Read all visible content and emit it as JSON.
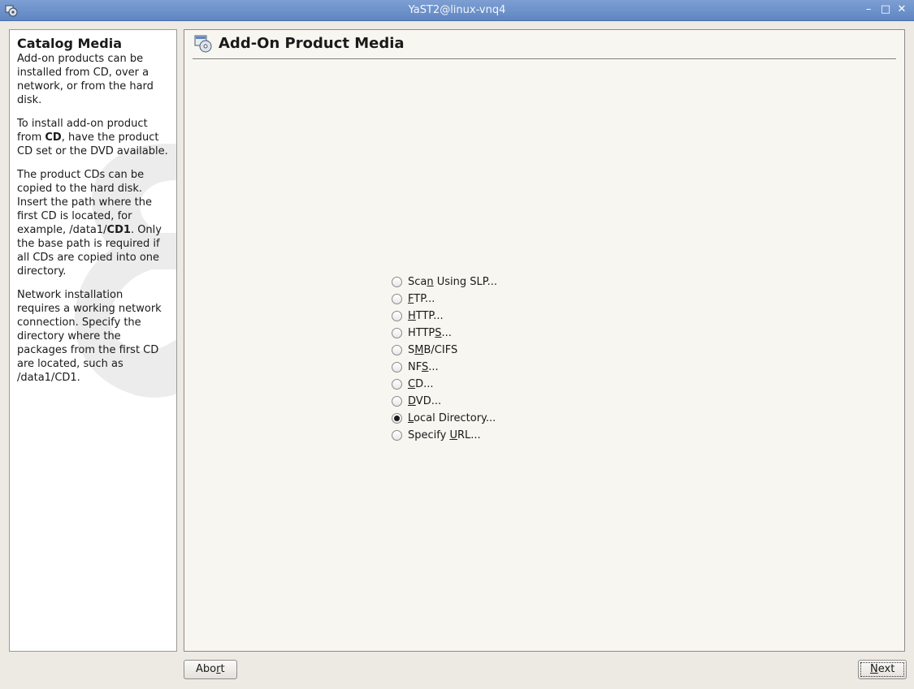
{
  "window": {
    "title": "YaST2@linux-vnq4"
  },
  "help": {
    "title": "Catalog Media",
    "paragraphs": [
      [
        "Add-on products can be installed from CD, over a network, or from the hard disk."
      ],
      [
        "To install add-on product from ",
        {
          "b": "CD"
        },
        ", have the product CD set or the DVD available."
      ],
      [
        "The product CDs can be copied to the hard disk. Insert the path where the first CD is located, for example, /data1/",
        {
          "b": "CD1"
        },
        ". Only the base path is required if all CDs are copied into one directory."
      ],
      [
        "Network installation requires a working network connection. Specify the directory where the packages from the first CD are located, such as /data1/CD1."
      ]
    ]
  },
  "main": {
    "title": "Add-On Product Media",
    "options": [
      {
        "label": "Scan Using SLP...",
        "mnemonic_index": 3,
        "checked": false
      },
      {
        "label": "FTP...",
        "mnemonic_index": 0,
        "checked": false
      },
      {
        "label": "HTTP...",
        "mnemonic_index": 0,
        "checked": false
      },
      {
        "label": "HTTPS...",
        "mnemonic_index": 4,
        "checked": false
      },
      {
        "label": "SMB/CIFS",
        "mnemonic_index": 1,
        "checked": false
      },
      {
        "label": "NFS...",
        "mnemonic_index": 2,
        "checked": false
      },
      {
        "label": "CD...",
        "mnemonic_index": 0,
        "checked": false
      },
      {
        "label": "DVD...",
        "mnemonic_index": 0,
        "checked": false
      },
      {
        "label": "Local Directory...",
        "mnemonic_index": 0,
        "checked": true
      },
      {
        "label": "Specify URL...",
        "mnemonic_index": 8,
        "checked": false
      }
    ]
  },
  "buttons": {
    "abort": "Abort",
    "abort_mnemonic": 3,
    "next": "Next",
    "next_mnemonic": 0
  }
}
